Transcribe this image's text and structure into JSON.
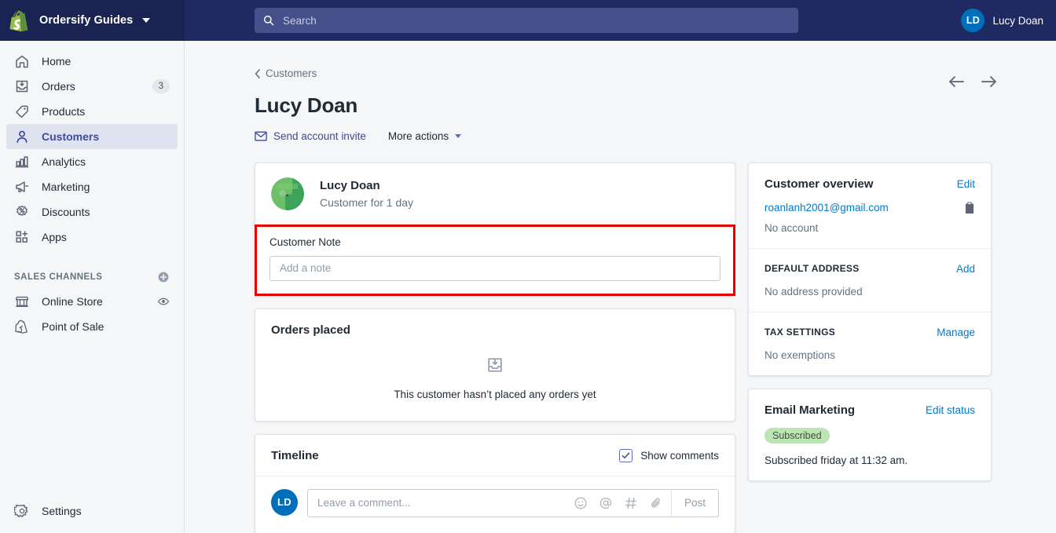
{
  "topbar": {
    "brand_name": "Ordersify Guides",
    "logo_icon": "shopify-bag-icon",
    "brand_caret_icon": "chevron-down-icon",
    "search": {
      "icon": "search-icon",
      "placeholder": "Search",
      "value": ""
    },
    "user": {
      "initials": "LD",
      "name": "Lucy Doan"
    }
  },
  "sidebar": {
    "items": [
      {
        "label": "Home",
        "icon": "home-icon",
        "active": false,
        "badge": ""
      },
      {
        "label": "Orders",
        "icon": "orders-inbox-icon",
        "active": false,
        "badge": "3"
      },
      {
        "label": "Products",
        "icon": "product-tag-icon",
        "active": false,
        "badge": ""
      },
      {
        "label": "Customers",
        "icon": "customer-person-icon",
        "active": true,
        "badge": ""
      },
      {
        "label": "Analytics",
        "icon": "analytics-bar-chart-icon",
        "active": false,
        "badge": ""
      },
      {
        "label": "Marketing",
        "icon": "marketing-megaphone-icon",
        "active": false,
        "badge": ""
      },
      {
        "label": "Discounts",
        "icon": "discount-percent-icon",
        "active": false,
        "badge": ""
      },
      {
        "label": "Apps",
        "icon": "apps-grid-plus-icon",
        "active": false,
        "badge": ""
      }
    ],
    "sales_channels": {
      "title": "SALES CHANNELS",
      "add_icon": "plus-circle-icon",
      "items": [
        {
          "label": "Online Store",
          "icon": "online-store-icon",
          "trailing_icon": "eye-icon"
        },
        {
          "label": "Point of Sale",
          "icon": "point-of-sale-icon",
          "trailing_icon": ""
        }
      ]
    },
    "settings": {
      "label": "Settings",
      "icon": "gear-icon"
    }
  },
  "page": {
    "breadcrumb": {
      "label": "Customers",
      "icon": "chevron-left-icon"
    },
    "title": "Lucy Doan",
    "actions": {
      "send_invite": {
        "label": "Send account invite",
        "icon": "envelope-icon"
      },
      "more_actions": {
        "label": "More actions",
        "icon": "chevron-down-icon"
      }
    },
    "pager": {
      "prev_icon": "arrow-left-icon",
      "next_icon": "arrow-right-icon"
    }
  },
  "customer_card": {
    "avatar_icon": "customer-avatar-green",
    "name": "Lucy Doan",
    "subtitle": "Customer for 1 day",
    "note": {
      "label": "Customer Note",
      "placeholder": "Add a note",
      "value": "",
      "highlight_color": "#e50000"
    }
  },
  "orders_card": {
    "title": "Orders placed",
    "empty_icon": "orders-inbox-icon",
    "empty_text": "This customer hasn’t placed any orders yet"
  },
  "timeline": {
    "title": "Timeline",
    "show_comments": {
      "label": "Show comments",
      "checked": true,
      "icon": "checkbox-checked-icon"
    },
    "composer": {
      "avatar_initials": "LD",
      "placeholder": "Leave a comment...",
      "value": "",
      "tools": [
        {
          "icon": "emoji-smiley-icon"
        },
        {
          "icon": "mention-at-icon"
        },
        {
          "icon": "hashtag-icon"
        },
        {
          "icon": "paperclip-attachment-icon"
        }
      ],
      "post_label": "Post"
    }
  },
  "customer_overview": {
    "title": "Customer overview",
    "edit_label": "Edit",
    "email": "roanlanh2001@gmail.com",
    "copy_icon": "clipboard-copy-icon",
    "account_status": "No account",
    "default_address": {
      "title": "DEFAULT ADDRESS",
      "action_label": "Add",
      "value": "No address provided"
    },
    "tax_settings": {
      "title": "TAX SETTINGS",
      "action_label": "Manage",
      "value": "No exemptions"
    }
  },
  "email_marketing": {
    "title": "Email Marketing",
    "action_label": "Edit status",
    "status_badge": "Subscribed",
    "status_color": "#bbe5b3",
    "detail": "Subscribed friday at 11:32 am."
  }
}
